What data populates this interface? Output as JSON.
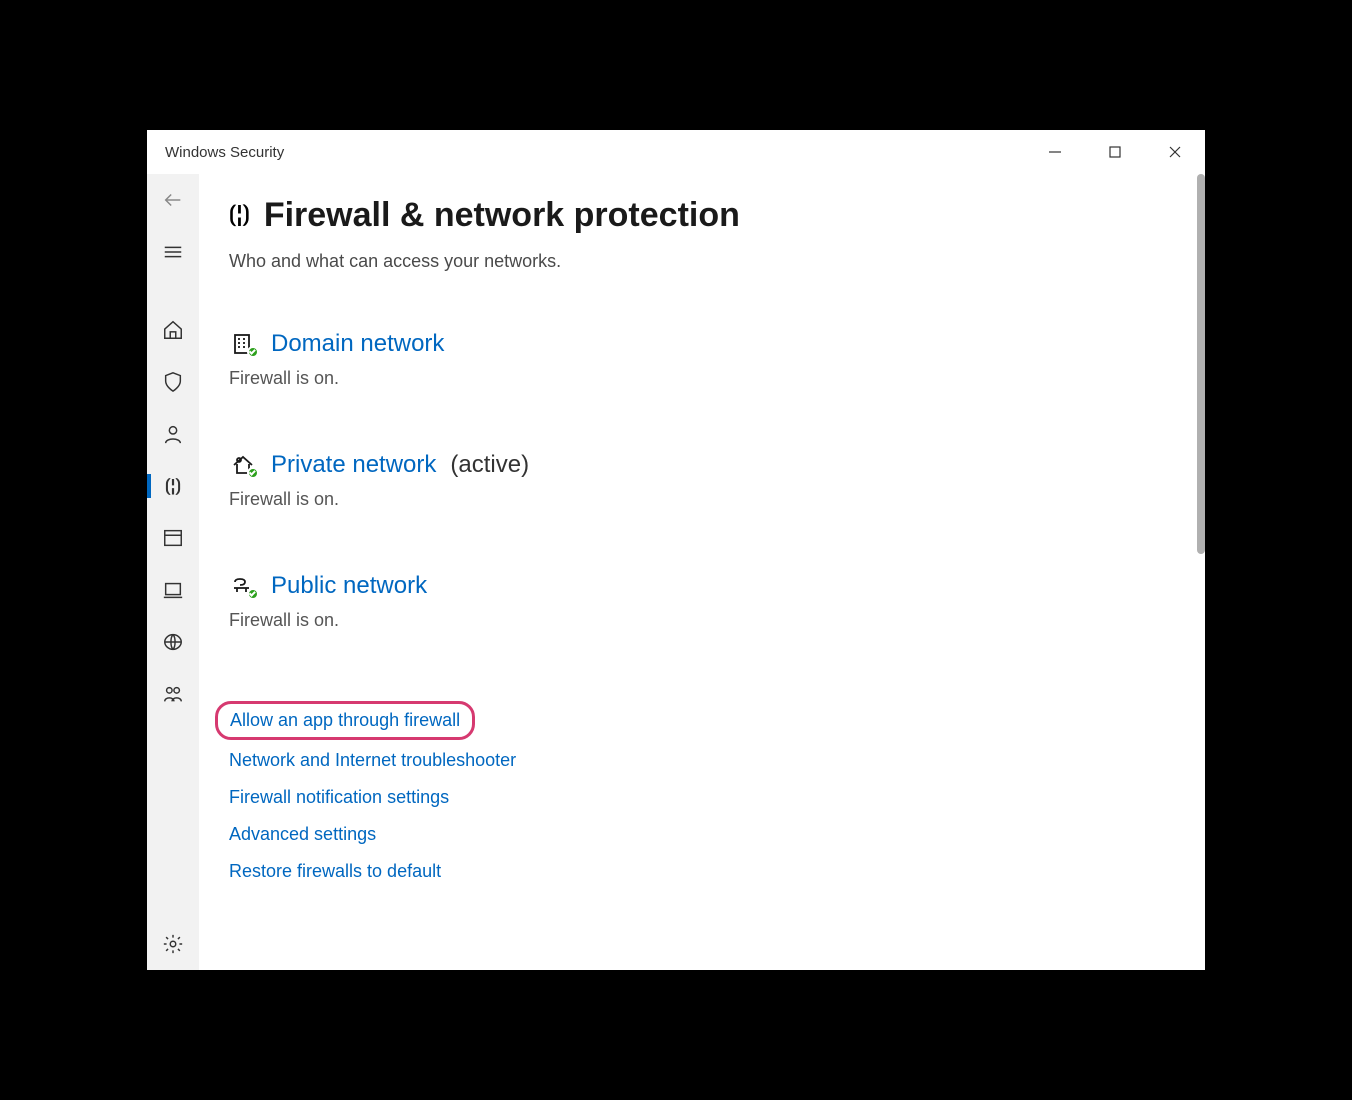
{
  "window": {
    "title": "Windows Security"
  },
  "page": {
    "title": "Firewall & network protection",
    "subtitle": "Who and what can access your networks."
  },
  "networks": {
    "domain": {
      "label": "Domain network",
      "status": "Firewall is on."
    },
    "private": {
      "label": "Private network",
      "active_tag": "(active)",
      "status": "Firewall is on."
    },
    "public": {
      "label": "Public network",
      "status": "Firewall is on."
    }
  },
  "links": {
    "allow_app": "Allow an app through firewall",
    "troubleshooter": "Network and Internet troubleshooter",
    "notifications": "Firewall notification settings",
    "advanced": "Advanced settings",
    "restore": "Restore firewalls to default"
  }
}
